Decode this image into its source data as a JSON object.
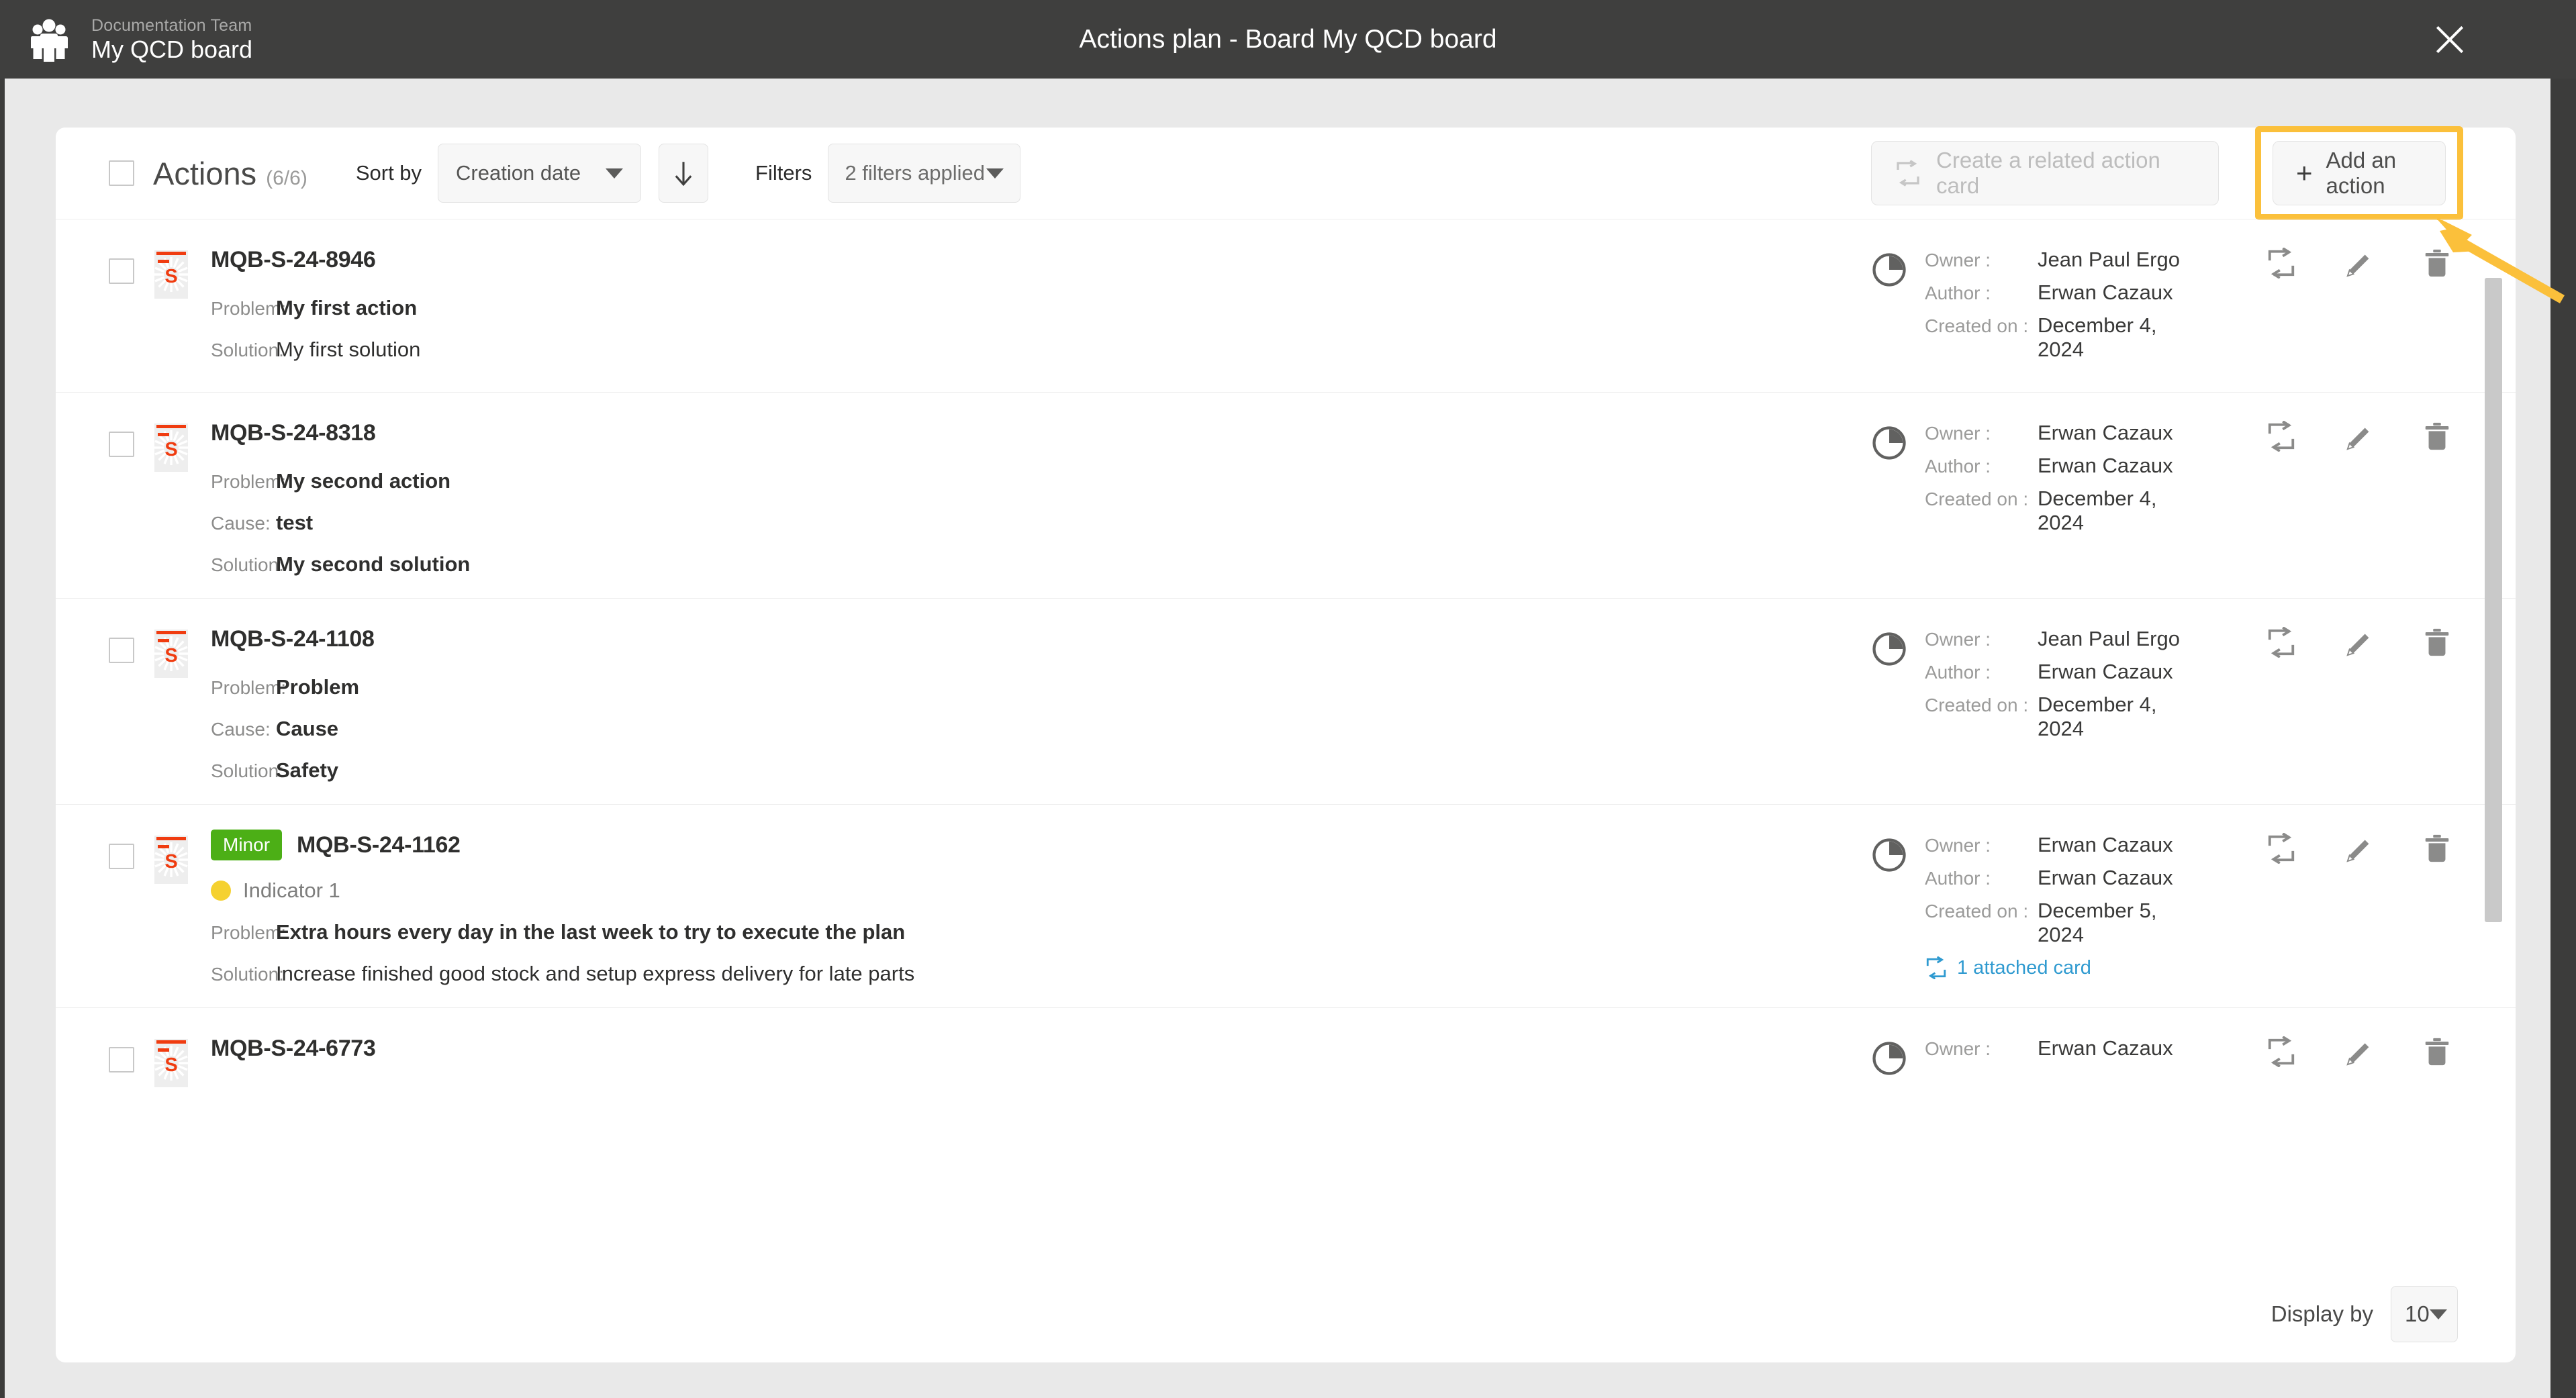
{
  "topbar": {
    "team_name": "Documentation Team",
    "board_name": "My QCD board",
    "modal_title": "Actions plan - Board My QCD board",
    "close_label": "×"
  },
  "toolbar": {
    "title": "Actions",
    "count": "(6/6)",
    "sort_by_label": "Sort by",
    "sort_value": "Creation date",
    "sort_direction": "descending",
    "filters_label": "Filters",
    "filters_value": "2 filters applied",
    "create_related_label": "Create a related action card",
    "add_action_label": "Add an action",
    "add_action_plus": "+",
    "highlight_color": "#fbc03b"
  },
  "labels": {
    "problem": "Problem:",
    "cause": "Cause:",
    "solution": "Solution:",
    "owner": "Owner :",
    "author": "Author :",
    "created_on": "Created on :"
  },
  "rows": [
    {
      "ref": "MQB-S-24-8946",
      "badge": null,
      "indicator": null,
      "problem": "My first action",
      "cause": null,
      "solution": "My first solution",
      "solution_bold": false,
      "owner": "Jean Paul Ergo",
      "author": "Erwan Cazaux",
      "created_on": "December 4, 2024",
      "attached": null
    },
    {
      "ref": "MQB-S-24-8318",
      "badge": null,
      "indicator": null,
      "problem": "My second action",
      "cause": "test",
      "solution": "My second solution",
      "solution_bold": true,
      "owner": "Erwan Cazaux",
      "author": "Erwan Cazaux",
      "created_on": "December 4, 2024",
      "attached": null
    },
    {
      "ref": "MQB-S-24-1108",
      "badge": null,
      "indicator": null,
      "problem": "Problem",
      "cause": "Cause",
      "solution": "Safety",
      "solution_bold": true,
      "owner": "Jean Paul Ergo",
      "author": "Erwan Cazaux",
      "created_on": "December 4, 2024",
      "attached": null
    },
    {
      "ref": "MQB-S-24-1162",
      "badge": "Minor",
      "badge_color": "#4caf16",
      "indicator": "Indicator 1",
      "indicator_color": "#f5d130",
      "problem": "Extra hours every day in the last week to try to execute the plan",
      "cause": null,
      "solution": "Increase finished good stock and setup express delivery for late parts",
      "solution_bold": false,
      "owner": "Erwan Cazaux",
      "author": "Erwan Cazaux",
      "created_on": "December 5, 2024",
      "attached": "1 attached card"
    },
    {
      "ref": "MQB-S-24-6773",
      "badge": null,
      "indicator": null,
      "problem": null,
      "cause": null,
      "solution": null,
      "solution_bold": false,
      "owner": "Erwan Cazaux",
      "author": null,
      "created_on": null,
      "attached": null
    }
  ],
  "footer": {
    "display_by_label": "Display by",
    "display_by_value": "10"
  }
}
